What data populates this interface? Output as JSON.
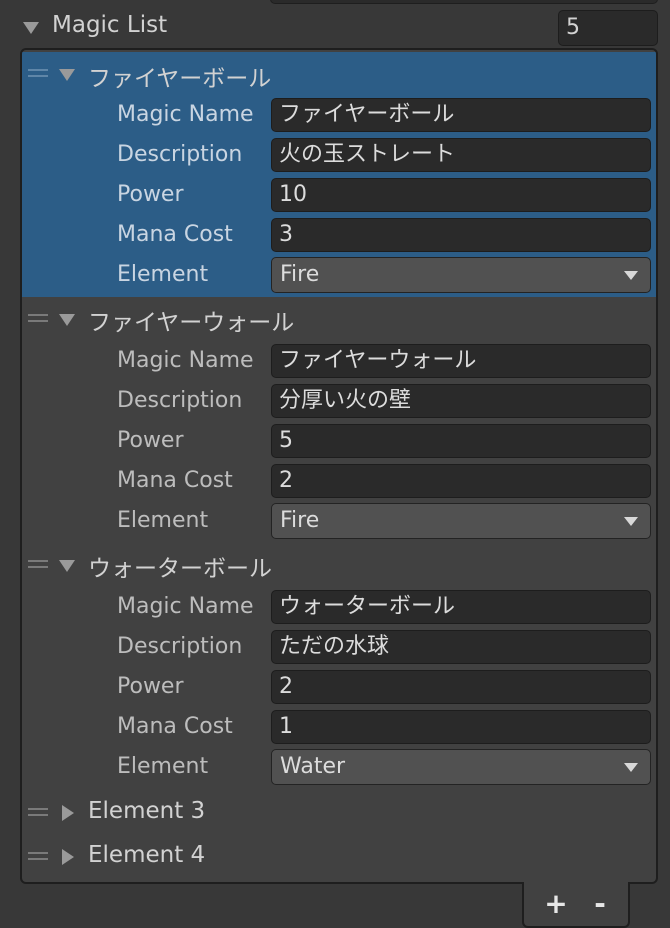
{
  "magic_list": {
    "title": "Magic List",
    "size": "5"
  },
  "labels": {
    "magic_name": "Magic Name",
    "description": "Description",
    "power": "Power",
    "mana_cost": "Mana Cost",
    "element": "Element"
  },
  "items": [
    {
      "title": "ファイヤーボール",
      "magic_name": "ファイヤーボール",
      "description": "火の玉ストレート",
      "power": "10",
      "mana_cost": "3",
      "element": "Fire"
    },
    {
      "title": "ファイヤーウォール",
      "magic_name": "ファイヤーウォール",
      "description": "分厚い火の壁",
      "power": "5",
      "mana_cost": "2",
      "element": "Fire"
    },
    {
      "title": "ウォーターボール",
      "magic_name": "ウォーターボール",
      "description": "ただの水球",
      "power": "2",
      "mana_cost": "1",
      "element": "Water"
    }
  ],
  "collapsed_items": [
    {
      "title": "Element 3"
    },
    {
      "title": "Element 4"
    }
  ],
  "footer": {
    "add_label": "+",
    "remove_label": "-"
  },
  "colors": {
    "selected_row": "#2c5d87",
    "panel_bg": "#414141",
    "window_bg": "#383838"
  }
}
